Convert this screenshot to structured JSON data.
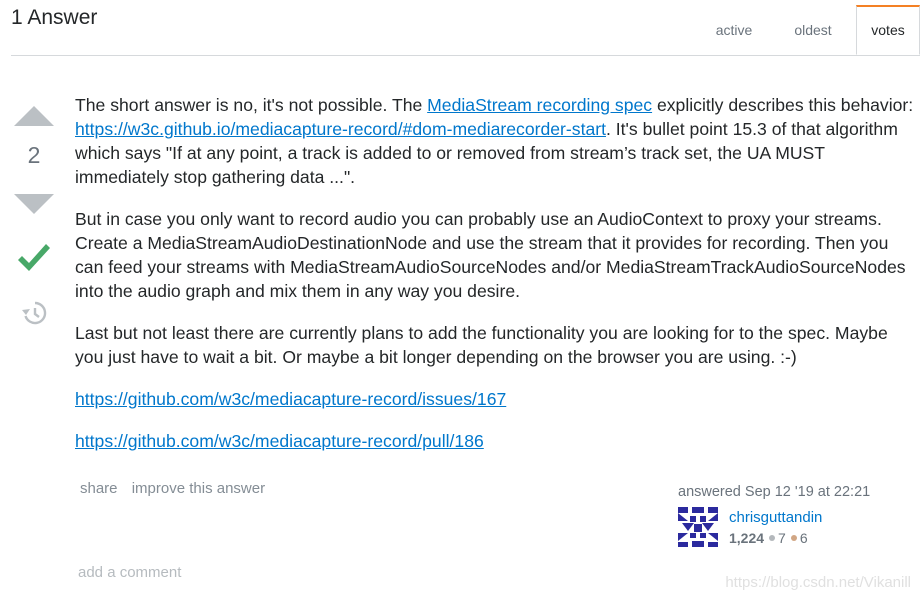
{
  "header": {
    "title": "1 Answer",
    "tabs": [
      "active",
      "oldest",
      "votes"
    ],
    "active_tab": "votes"
  },
  "vote": {
    "count": "2"
  },
  "post": {
    "p1_a": "The short answer is no, it's not possible. The ",
    "p1_link1": "MediaStream recording spec",
    "p1_b": " explicitly describes this behavior: ",
    "p1_link2": "https://w3c.github.io/mediacapture-record/#dom-mediarecorder-start",
    "p1_c": ". It's bullet point 15.3 of that algorithm which says \"If at any point, a track is added to or removed from stream’s track set, the UA MUST immediately stop gathering data ...\".",
    "p2": "But in case you only want to record audio you can probably use an AudioContext to proxy your streams. Create a MediaStreamAudioDestinationNode and use the stream that it provides for recording. Then you can feed your streams with MediaStreamAudioSourceNodes and/or MediaStreamTrackAudioSourceNodes into the audio graph and mix them in any way you desire.",
    "p3": "Last but not least there are currently plans to add the functionality you are looking for to the spec. Maybe you just have to wait a bit. Or maybe a bit longer depending on the browser you are using. :-)",
    "link_issue": "https://github.com/w3c/mediacapture-record/issues/167",
    "link_pull": "https://github.com/w3c/mediacapture-record/pull/186"
  },
  "menu": {
    "share": "share",
    "improve": "improve this answer"
  },
  "signature": {
    "time": "answered Sep 12 '19 at 22:21",
    "user": "chrisguttandin",
    "reputation": "1,224",
    "silver": "7",
    "bronze": "6"
  },
  "comments": {
    "add": "add a comment"
  },
  "watermark": "https://blog.csdn.net/Vikanill",
  "colors": {
    "link": "#0077cc",
    "accepted": "#48a868",
    "arrow": "#bbc0c4",
    "tab_accent": "#f48024"
  },
  "icons": [
    "upvote-arrow-icon",
    "downvote-arrow-icon",
    "accepted-check-icon",
    "history-icon"
  ]
}
